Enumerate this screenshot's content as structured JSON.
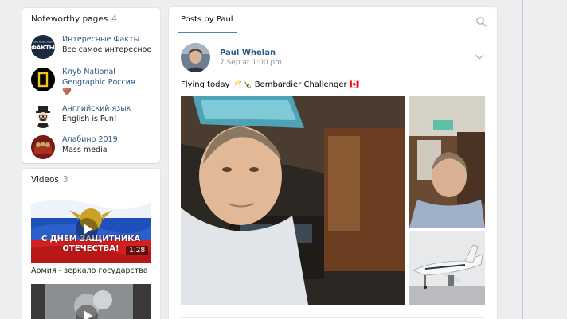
{
  "noteworthy": {
    "title": "Noteworthy pages",
    "count": "4",
    "items": [
      {
        "name": "Интересные Факты",
        "sub": "Все самое интересное ",
        "icon": "facts-page-avatar"
      },
      {
        "name": "Клуб National Geographic Россия",
        "sub": "🤎 ",
        "icon": "natgeo-page-avatar"
      },
      {
        "name": "Английский язык",
        "sub": "English is Fun!",
        "icon": "gentleman-page-avatar"
      },
      {
        "name": "Алабино 2019",
        "sub": "Mass media",
        "icon": "alabino-page-avatar"
      }
    ]
  },
  "videos": {
    "title": "Videos",
    "count": "3",
    "items": [
      {
        "overlay_line1": "С ДНЕМ ЗАЩИТНИКА",
        "overlay_line2": "ОТЕЧЕСТВА!",
        "duration": "1:28",
        "caption": "Армия - зеркало государства"
      }
    ]
  },
  "posts": {
    "tab_label": "Posts by Paul",
    "author": "Paul Whelan",
    "date": "7 Sep at 1:00 pm",
    "text": "Flying today 🥂🍾 Bombardier Challenger 🇨🇦"
  },
  "colors": {
    "link": "#2a5885",
    "accent": "#5181b8",
    "background": "#edeef0"
  }
}
